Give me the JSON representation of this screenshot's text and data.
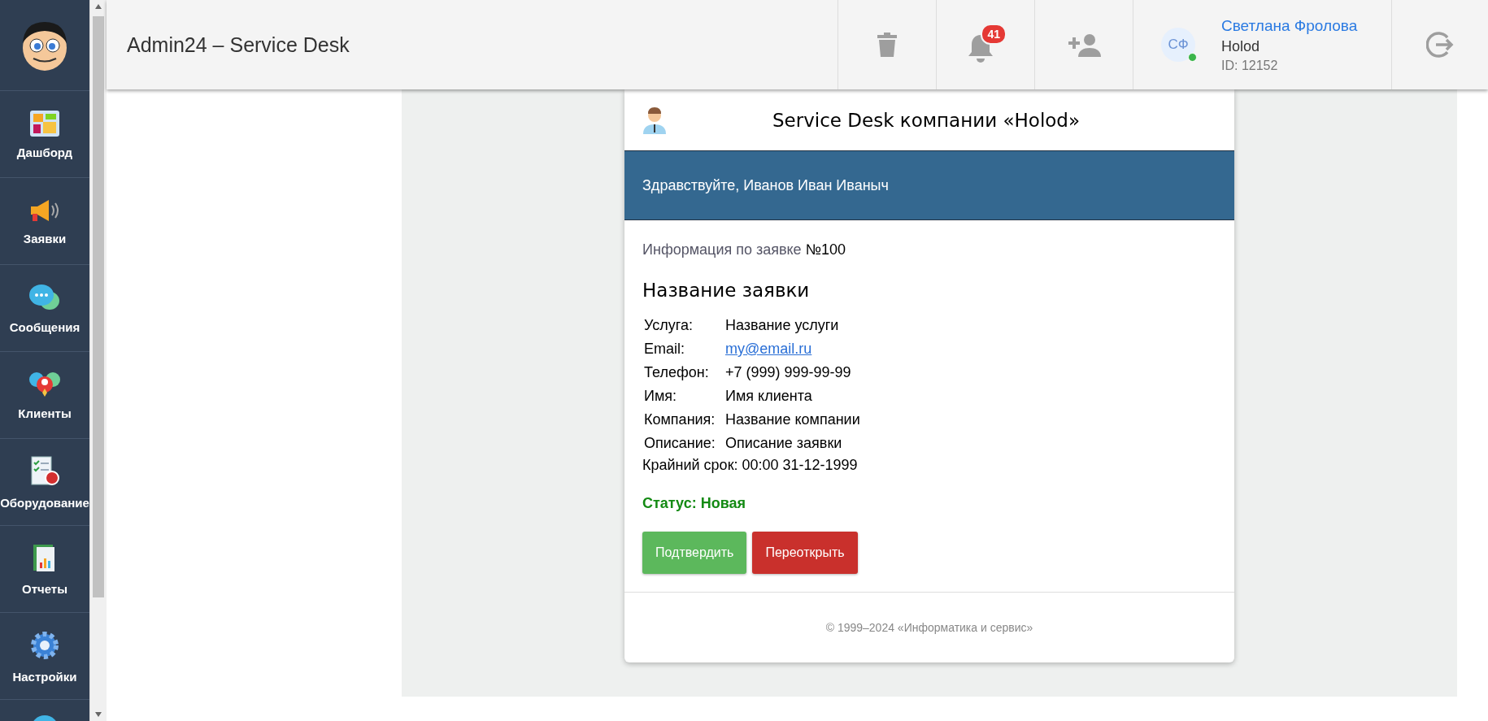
{
  "sidebar": {
    "items": [
      {
        "label": "Дашборд"
      },
      {
        "label": "Заявки"
      },
      {
        "label": "Сообщения"
      },
      {
        "label": "Клиенты"
      },
      {
        "label": "Оборудование"
      },
      {
        "label": "Отчеты"
      },
      {
        "label": "Настройки"
      }
    ]
  },
  "header": {
    "title": "Admin24 – Service Desk",
    "notifications_count": "41",
    "user": {
      "initials": "СФ",
      "name": "Светлана Фролова",
      "company": "Holod",
      "id": "ID: 12152",
      "online": true
    }
  },
  "card": {
    "title": "Service Desk компании «Holod»",
    "greeting": "Здравствуйте, Иванов Иван Иваныч",
    "info_label": "Информация по заявке",
    "info_number": "№100",
    "request_title": "Название заявки",
    "fields": [
      {
        "label": "Услуга:",
        "value": "Название услуги",
        "kind": "text"
      },
      {
        "label": "Email:",
        "value": "my@email.ru",
        "kind": "link"
      },
      {
        "label": "Телефон:",
        "value": "+7 (999) 999-99-99",
        "kind": "text"
      },
      {
        "label": "Имя:",
        "value": "Имя клиента",
        "kind": "text"
      },
      {
        "label": "Компания:",
        "value": "Название компании",
        "kind": "text"
      },
      {
        "label": "Описание:",
        "value": "Описание заявки",
        "kind": "text"
      }
    ],
    "deadline": "Крайний срок: 00:00 31-12-1999",
    "status": "Статус: Новая",
    "buttons": [
      {
        "label": "Подтвердить",
        "kind": "confirm"
      },
      {
        "label": "Переоткрыть",
        "kind": "reopen"
      }
    ],
    "footer": "© 1999–2024 «Информатика и сервис»"
  }
}
